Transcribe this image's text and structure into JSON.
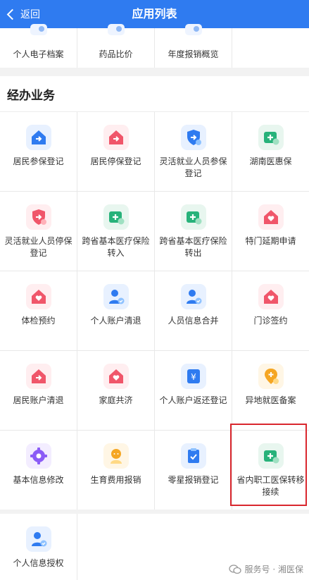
{
  "header": {
    "back_label": "返回",
    "title": "应用列表"
  },
  "top_row": [
    "个人电子档案",
    "药品比价",
    "年度报销概览",
    ""
  ],
  "section": {
    "title": "经办业务"
  },
  "items": [
    {
      "label": "居民参保登记",
      "icon": "house-arrow-icon",
      "style": "blue"
    },
    {
      "label": "居民停保登记",
      "icon": "house-arrow-icon",
      "style": "red"
    },
    {
      "label": "灵活就业人员参保登记",
      "icon": "shield-arrow-icon",
      "style": "blue"
    },
    {
      "label": "湖南医惠保",
      "icon": "plus-card-icon",
      "style": "green"
    },
    {
      "label": "灵活就业人员停保登记",
      "icon": "shield-arrow-icon",
      "style": "red"
    },
    {
      "label": "跨省基本医疗保险转入",
      "icon": "plus-card-icon",
      "style": "green"
    },
    {
      "label": "跨省基本医疗保险转出",
      "icon": "plus-card-icon",
      "style": "green"
    },
    {
      "label": "特门延期申请",
      "icon": "house-heart-icon",
      "style": "red"
    },
    {
      "label": "体检预约",
      "icon": "house-heart-icon",
      "style": "red"
    },
    {
      "label": "个人账户清退",
      "icon": "user-check-icon",
      "style": "blue"
    },
    {
      "label": "人员信息合并",
      "icon": "user-check-icon",
      "style": "blue"
    },
    {
      "label": "门诊签约",
      "icon": "house-heart-icon",
      "style": "red"
    },
    {
      "label": "居民账户清退",
      "icon": "house-arrow-icon",
      "style": "red"
    },
    {
      "label": "家庭共济",
      "icon": "house-heart-icon",
      "style": "red"
    },
    {
      "label": "个人账户返还登记",
      "icon": "yen-box-icon",
      "style": "blue"
    },
    {
      "label": "异地就医备案",
      "icon": "location-plus-icon",
      "style": "yellow"
    },
    {
      "label": "基本信息修改",
      "icon": "gear-icon",
      "style": "purple"
    },
    {
      "label": "生育费用报销",
      "icon": "baby-icon",
      "style": "yellow"
    },
    {
      "label": "零星报销登记",
      "icon": "clipboard-check-icon",
      "style": "blue"
    },
    {
      "label": "省内职工医保转移接续",
      "icon": "plus-card-icon",
      "style": "green"
    }
  ],
  "last_item": {
    "label": "个人信息授权",
    "icon": "user-check-icon",
    "style": "blue"
  },
  "watermark": {
    "text": "服务号 · 湘医保"
  }
}
